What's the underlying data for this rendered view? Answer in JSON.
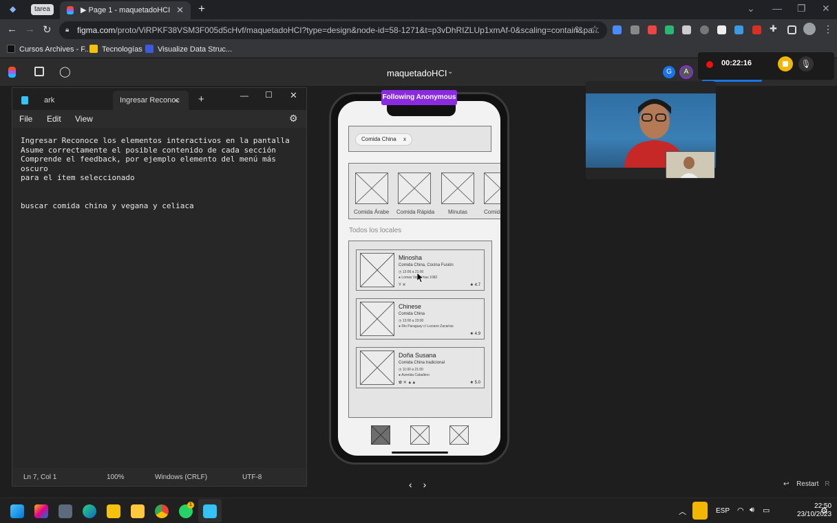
{
  "browser": {
    "tab_group": "tarea",
    "active_tab": "▶ Page 1 - maquetadoHCI",
    "new_tab": "+",
    "url_host": "figma.com",
    "url_rest": "/proto/ViRPKF38VSM3F005d5cHvf/maquetadoHCI?type=design&node-id=58-1271&t=p3vDhRIZLUp1xmAf-0&scaling=contain&pa...",
    "bookmarks": [
      "Cursos Archives - F...",
      "Tecnologías",
      "Visualize Data Struc..."
    ]
  },
  "figma": {
    "title": "maquetadoHCI",
    "avatars": [
      "G",
      "A"
    ]
  },
  "recorder": {
    "time": "00:22:16"
  },
  "notepad": {
    "tabs": [
      "ark",
      "Ingresar Reconoc"
    ],
    "menu": [
      "File",
      "Edit",
      "View"
    ],
    "text": "Ingresar Reconoce los elementos interactivos en la pantalla\nAsume correctamente el posible contenido de cada sección\nComprende el feedback, por ejemplo elemento del menú más oscuro\npara el ítem seleccionado\n\n\nbuscar comida china y vegana y celiaca",
    "status": {
      "position": "Ln 7, Col 1",
      "zoom": "100%",
      "line_ending": "Windows (CRLF)",
      "encoding": "UTF-8"
    }
  },
  "prototype": {
    "follow_banner": "Following Anonymous",
    "search_chip": "Comida China",
    "chip_close": "x",
    "categories": [
      "Comida Árabe",
      "Comida Rápida",
      "Minutas",
      "Comida"
    ],
    "section_title": "Todos los locales",
    "restaurants": [
      {
        "name": "Minosha",
        "type": "Comida China, Cocina Fusión",
        "hours": "◷ 13:00 a 21:00",
        "address": "● Lomas Valentinas 1082",
        "icons": "Y ✕",
        "rating": "★ 4.7"
      },
      {
        "name": "Chinese",
        "type": "Comida China",
        "hours": "◷ 13:00 a 23:00",
        "address": "● Rio Paraguay c/ Luciano Zacarías",
        "icons": "",
        "rating": "★ 4.9"
      },
      {
        "name": "Doña Susana",
        "type": "Comida China tradicional",
        "hours": "◷ 11:00 a 21:00",
        "address": "● Avenida Caballero",
        "icons": "✿ ✕ ▲▲",
        "rating": "★ 5.0"
      }
    ]
  },
  "overlay": {
    "prev": "‹",
    "next": "›",
    "restart": "Restart",
    "restart_key": "R"
  },
  "taskbar": {
    "lang": "ESP",
    "time": "22:50",
    "date": "23/10/2023",
    "whatsapp_badge": "1"
  }
}
